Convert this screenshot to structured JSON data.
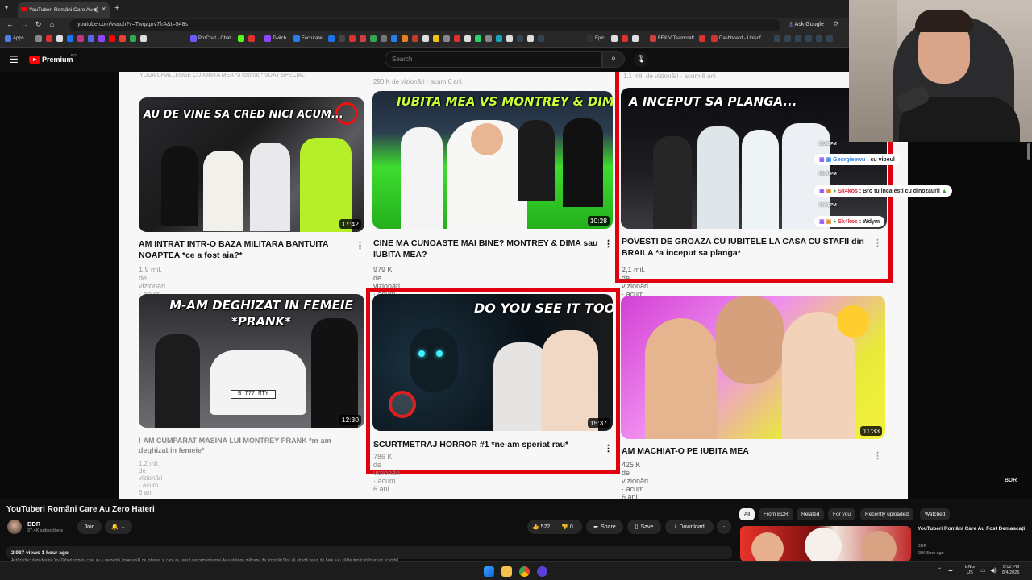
{
  "browser": {
    "tab_title": "YouTuberi Români Care Au",
    "url": "youtube.com/watch?v=Twqaprv7frA&t=548s",
    "ask_google": "Ask Google",
    "new_tab": "+",
    "bookmarks": [
      {
        "label": "Apps",
        "color": "#4f7ee8"
      },
      {
        "label": "ProChat - Chat",
        "color": "#6a5cff"
      },
      {
        "label": "Twitch",
        "color": "#9146ff"
      },
      {
        "label": "Facturare",
        "color": "#2b7de9"
      },
      {
        "label": "Epic",
        "color": "#333333"
      },
      {
        "label": "FFXIV Teamcraft",
        "color": "#d04040"
      },
      {
        "label": "Dashboard - Ubisof...",
        "color": "#cc3333"
      }
    ]
  },
  "youtube": {
    "brand": "Premium",
    "region": "RO",
    "search_placeholder": "Search"
  },
  "video_frame": {
    "watermark": "BDR",
    "cards": [
      {
        "title": "AM INTRAT INTR-O BAZA MILITARA BANTUITA NOAPTEA *ce a fost aia?*",
        "meta": "1,9 mil. de vizionări · acum 6 ani",
        "duration": "17:42",
        "overlay": "AU DE VINE SA CRED NICI ACUM..."
      },
      {
        "title": "CINE MA CUNOASTE MAI BINE? MONTREY & DIMA sau IUBITA MEA?",
        "meta": "979 K de vizionări · acum 6 ani",
        "duration": "10:28",
        "overlay": "IUBITA MEA VS MONTREY & DIMA"
      },
      {
        "title": "POVESTI DE GROAZA CU IUBITELE LA CASA CU STAFII din BRAILA *a inceput sa planga*",
        "meta": "2,1 mil. de vizionări · acum 6 ani",
        "duration": "",
        "overlay": "A INCEPUT SA PLANGA..."
      },
      {
        "title": "I-AM CUMPARAT MASINA LUI MONTREY PRANK *m-am deghizat in femeie*",
        "meta": "1,2 mil. de vizionări · acum 6 ani",
        "duration": "12:30",
        "overlay": "M-AM DEGHIZAT IN FEMEIE *PRANK*"
      },
      {
        "title": "SCURTMETRAJ HORROR #1 *ne-am speriat rau*",
        "meta": "786 K de vizionări · acum 6 ani",
        "duration": "15:37",
        "overlay": "DO YOU SEE IT TOO?"
      },
      {
        "title": "AM MACHIAT-O PE IUBITA MEA",
        "meta": "425 K de vizionări · acum 6 ani",
        "duration": "11:33",
        "overlay": ""
      }
    ],
    "top_fragments": {
      "left": "YOGA CHALLENGE CU IUBITA MEA *a fost rau* VDAY SPECIAL",
      "mid": "290 K de vizionări · acum 6 ani",
      "right": "1,1 mil. de vizionări · acum 6 ani"
    },
    "plate": "B 777 MTY"
  },
  "chat": [
    {
      "time": "08:00 PM",
      "user": "Georgieewu",
      "text": ": cu vibeul"
    },
    {
      "time": "08:00 PM",
      "user": "Sk4kos",
      "text": ": Bro tu inca esti cu dinozaurii"
    },
    {
      "time": "08:01 PM",
      "user": "Sk4kos",
      "text": ": Wdym"
    }
  ],
  "watch": {
    "title": "YouTuberi Români Care Au Zero Hateri",
    "channel": "BDR",
    "subscribers": "37.4K subscribers",
    "join": "Join",
    "likes": "522",
    "dislikes": "0",
    "share": "Share",
    "save": "Save",
    "download": "Download",
    "views": "2,937 views  1 hour ago",
    "description": "Astăzi discutăm despre YouTuberi români care au o prezență impecabilă pe internet și care au reușit performanța mai de a strânge milioane de vizionări fără să atragă valuri de hate sau să fie implicați în vreun scandal."
  },
  "filters": [
    "All",
    "From BDR",
    "Related",
    "For you",
    "Recently uploaded",
    "Watched"
  ],
  "recommended": {
    "title": "YouTuberi Români Care Au Fost Demascați",
    "channel": "BDR",
    "meta": "68K  5mo ago"
  },
  "taskbar": {
    "lang_top": "ENG",
    "lang_bottom": "US",
    "time": "8:02 PM",
    "date": "8/4/2026"
  }
}
